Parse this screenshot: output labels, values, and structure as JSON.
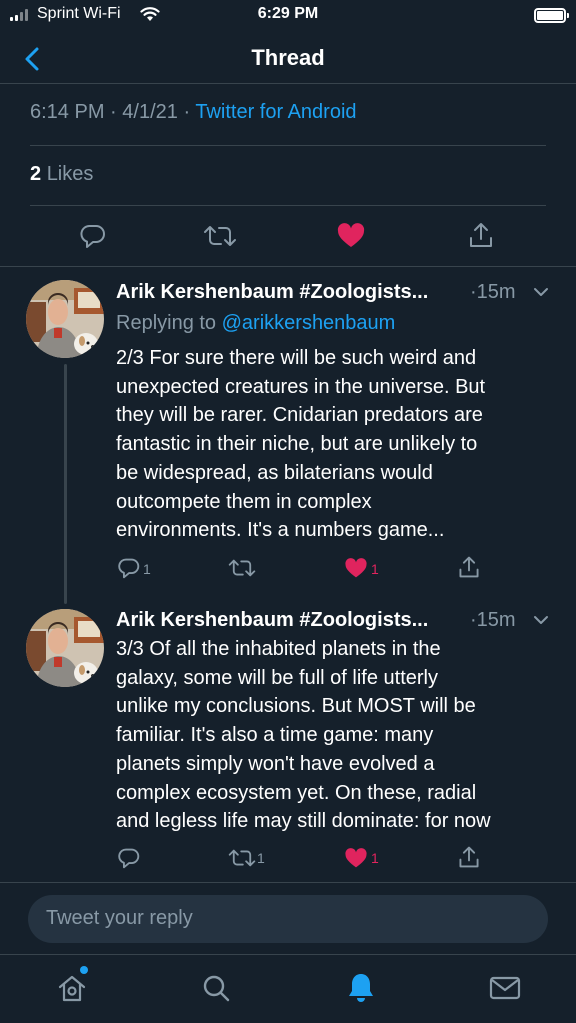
{
  "status_bar": {
    "carrier": "Sprint Wi-Fi",
    "time": "6:29 PM"
  },
  "nav": {
    "title": "Thread"
  },
  "main_tweet": {
    "time": "6:14 PM",
    "separator": "·",
    "date": "4/1/21",
    "source": "Twitter for Android",
    "likes_count": "2",
    "likes_label": "Likes"
  },
  "tweets": [
    {
      "author": "Arik Kershenbaum #Zoologists...",
      "time": "·15m",
      "replying_label": "Replying to",
      "replying_handle": "@arikkershenbaum",
      "lines": [
        "2/3 For sure there will be such weird and",
        "unexpected creatures in the universe. But",
        "they will be rarer. Cnidarian predators are",
        "fantastic in their niche, but are unlikely to",
        "be widespread, as bilaterians would",
        "outcompete them in complex",
        "environments. It's a numbers game..."
      ],
      "reply_count": "1",
      "retweet_count": "",
      "like_count": "1"
    },
    {
      "author": "Arik Kershenbaum #Zoologists...",
      "time": "·15m",
      "lines": [
        "3/3 Of all the inhabited planets in the",
        "galaxy, some will be full of life utterly",
        "unlike my conclusions. But MOST will be",
        "familiar. It's also a time game: many",
        "planets simply won't have evolved a",
        "complex ecosystem yet. On these, radial",
        "and legless life may still dominate: for now"
      ],
      "reply_count": "",
      "retweet_count": "1",
      "like_count": "1"
    }
  ],
  "reply_bar": {
    "placeholder": "Tweet your reply"
  },
  "colors": {
    "background": "#15202b",
    "accent": "#1da1f2",
    "like": "#e0245e",
    "muted": "#8899a6",
    "divider": "#38444d"
  },
  "icons": {
    "back": "chevron-left-icon",
    "reply": "speech-bubble-icon",
    "retweet": "retweet-icon",
    "like": "heart-icon",
    "share": "share-icon",
    "home": "home-icon",
    "search": "search-icon",
    "notifications": "bell-icon",
    "messages": "envelope-icon"
  }
}
